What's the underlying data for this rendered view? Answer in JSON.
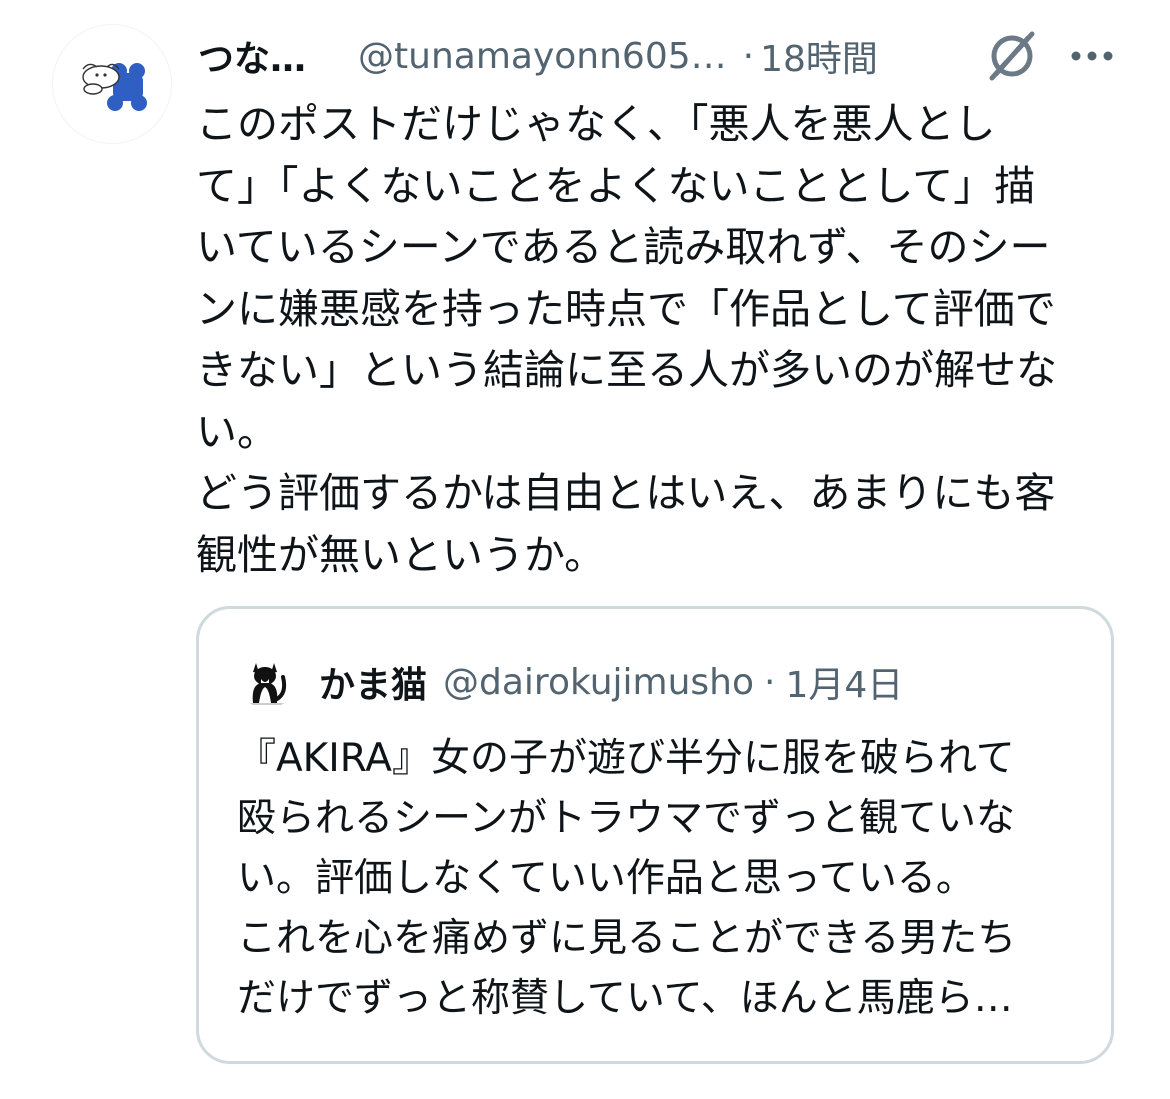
{
  "post": {
    "display_name": "つな…",
    "handle": "@tunamayonn605…",
    "separator": "·",
    "timestamp": "18時間",
    "body": "このポストだけじゃなく、「悪人を悪人とし\nて」「よくないことをよくないこととして」描\nいているシーンであると読み取れず、そのシー\nンに嫌悪感を持った時点で「作品として評価で\nきない」という結論に至る人が多いのが解せな\nい。\nどう評価するかは自由とはいえ、あまりにも客\n観性が無いというか。"
  },
  "quote": {
    "display_name": "かま猫",
    "handle": "@dairokujimusho",
    "separator": "·",
    "timestamp": "1月4日",
    "body": "『AKIRA』女の子が遊び半分に服を破られて\n殴られるシーンがトラウマでずっと観ていな\nい。評価しなくていい作品と思っている。\nこれを心を痛めずに見ることができる男たち\nだけでずっと称賛していて、ほんと馬鹿ら…"
  },
  "icons": {
    "avatar": "blue-dog-avatar-icon",
    "grok": "grok-icon",
    "more": "more-options-icon",
    "quote_avatar": "cat-avatar-icon"
  },
  "colors": {
    "text_primary": "#0f1419",
    "text_secondary": "#536471",
    "card_border": "#cfd9de",
    "avatar_blue": "#2f5fc2"
  }
}
